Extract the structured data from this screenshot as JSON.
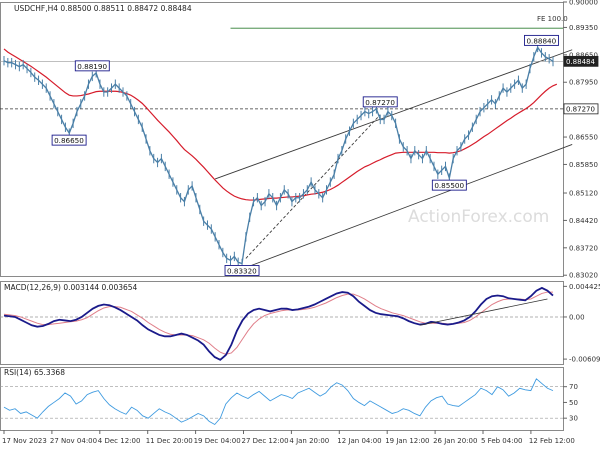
{
  "colors": {
    "price": "#4a7fa7",
    "ema": "#d61c2b",
    "grid": "#c8c8c8",
    "box_border": "#1a1a8a",
    "trend": "#3a3a3a",
    "macd": "#1a1a8a",
    "signal": "#e07f8a",
    "rsi": "#3f9be0",
    "watermark": "#dcdcdc"
  },
  "chart_data": [
    {
      "type": "line",
      "panel": "price",
      "title": "USDCHF,H4  0.88500 0.88511 0.88472 0.88484",
      "watermark": "ActionForex.com",
      "ylim": [
        0.83,
        0.9
      ],
      "y_ticks": [
        "0.90000",
        "0.89350",
        "0.88650",
        "0.87950",
        "0.87270",
        "0.86550",
        "0.85850",
        "0.85120",
        "0.84420",
        "0.83720",
        "0.83020"
      ],
      "last_price_label": "0.88484",
      "level_label": "0.87270",
      "fe_label": "FE 100.0",
      "fe_level": 0.8933,
      "dashed_level": 0.8727,
      "annotations": [
        {
          "text": "0.88190",
          "x": 23,
          "y": 0.8819
        },
        {
          "text": "0.86650",
          "x": 18,
          "y": 0.8665
        },
        {
          "text": "0.83320",
          "x": 62,
          "y": 0.8332
        },
        {
          "text": "0.87270",
          "x": 98,
          "y": 0.8727
        },
        {
          "text": "0.85500",
          "x": 116,
          "y": 0.855
        },
        {
          "text": "0.88840",
          "x": 140,
          "y": 0.8884
        }
      ],
      "x_ticks": [
        "17 Nov 2023",
        "27 Nov 04:00",
        "4 Dec 12:00",
        "11 Dec 20:00",
        "19 Dec 04:00",
        "27 Dec 12:00",
        "4 Jan 20:00",
        "12 Jan 04:00",
        "19 Jan 12:00",
        "26 Jan 20:00",
        "5 Feb 04:00",
        "12 Feb 12:00"
      ],
      "series": [
        {
          "role": "price",
          "values": [
            0.885,
            0.8845,
            0.8845,
            0.884,
            0.8835,
            0.884,
            0.883,
            0.882,
            0.8808,
            0.88,
            0.879,
            0.878,
            0.876,
            0.874,
            0.872,
            0.87,
            0.868,
            0.8665,
            0.869,
            0.872,
            0.874,
            0.876,
            0.879,
            0.881,
            0.8819,
            0.879,
            0.877,
            0.877,
            0.878,
            0.879,
            0.878,
            0.877,
            0.876,
            0.874,
            0.872,
            0.87,
            0.868,
            0.865,
            0.862,
            0.86,
            0.859,
            0.86,
            0.858,
            0.856,
            0.854,
            0.852,
            0.85,
            0.849,
            0.852,
            0.853,
            0.85,
            0.847,
            0.844,
            0.843,
            0.842,
            0.84,
            0.838,
            0.836,
            0.8345,
            0.834,
            0.835,
            0.8335,
            0.8332,
            0.84,
            0.845,
            0.849,
            0.85,
            0.848,
            0.849,
            0.851,
            0.85,
            0.848,
            0.85,
            0.852,
            0.851,
            0.849,
            0.85,
            0.85,
            0.851,
            0.852,
            0.854,
            0.852,
            0.851,
            0.85,
            0.852,
            0.854,
            0.856,
            0.86,
            0.862,
            0.865,
            0.867,
            0.869,
            0.87,
            0.871,
            0.872,
            0.8715,
            0.872,
            0.8727,
            0.87,
            0.87,
            0.872,
            0.871,
            0.869,
            0.865,
            0.863,
            0.862,
            0.86,
            0.862,
            0.861,
            0.86,
            0.862,
            0.86,
            0.858,
            0.856,
            0.857,
            0.858,
            0.855,
            0.86,
            0.862,
            0.863,
            0.865,
            0.866,
            0.868,
            0.87,
            0.872,
            0.873,
            0.874,
            0.875,
            0.874,
            0.876,
            0.878,
            0.877,
            0.878,
            0.879,
            0.88,
            0.878,
            0.879,
            0.883,
            0.886,
            0.8884,
            0.887,
            0.886,
            0.8855,
            0.8848
          ]
        },
        {
          "role": "ema",
          "values": [
            0.888,
            0.8872,
            0.8866,
            0.886,
            0.8854,
            0.8848,
            0.8842,
            0.8836,
            0.8829,
            0.8822,
            0.8815,
            0.8808,
            0.88,
            0.8792,
            0.8784,
            0.8776,
            0.8768,
            0.8762,
            0.876,
            0.876,
            0.8761,
            0.8763,
            0.8765,
            0.8768,
            0.8771,
            0.8772,
            0.8772,
            0.8772,
            0.8772,
            0.8772,
            0.8771,
            0.8769,
            0.8766,
            0.8762,
            0.8756,
            0.8749,
            0.8741,
            0.8731,
            0.872,
            0.8709,
            0.8698,
            0.8688,
            0.8678,
            0.8668,
            0.8657,
            0.8646,
            0.8634,
            0.8623,
            0.8615,
            0.8607,
            0.8598,
            0.8588,
            0.8578,
            0.8567,
            0.8556,
            0.8545,
            0.8535,
            0.8525,
            0.8517,
            0.851,
            0.8504,
            0.85,
            0.8497,
            0.8495,
            0.8494,
            0.8494,
            0.8495,
            0.8496,
            0.8497,
            0.8498,
            0.8499,
            0.8499,
            0.85,
            0.8501,
            0.8502,
            0.8502,
            0.8503,
            0.8504,
            0.8505,
            0.8507,
            0.8509,
            0.851,
            0.8512,
            0.8514,
            0.8517,
            0.8521,
            0.8526,
            0.8532,
            0.8539,
            0.8546,
            0.8553,
            0.856,
            0.8567,
            0.8573,
            0.8579,
            0.8583,
            0.8588,
            0.8593,
            0.8597,
            0.8602,
            0.8606,
            0.861,
            0.8614,
            0.8615,
            0.8616,
            0.8616,
            0.8616,
            0.8616,
            0.8616,
            0.8616,
            0.8616,
            0.8616,
            0.8616,
            0.8615,
            0.8615,
            0.8615,
            0.8614,
            0.8615,
            0.8617,
            0.862,
            0.8625,
            0.863,
            0.8636,
            0.8642,
            0.8649,
            0.8656,
            0.8662,
            0.8669,
            0.8676,
            0.8683,
            0.869,
            0.8697,
            0.8703,
            0.871,
            0.8716,
            0.8722,
            0.8728,
            0.8735,
            0.8743,
            0.8753,
            0.8763,
            0.8772,
            0.878,
            0.8786,
            0.879
          ]
        }
      ]
    },
    {
      "type": "line",
      "panel": "macd",
      "title": "MACD(12,26,9) 0.003144 0.003654",
      "ylim": [
        -0.0068,
        0.0052
      ],
      "y_ticks": [
        "0.004425",
        "0.00",
        "-0.006092"
      ],
      "series": [
        {
          "role": "macd",
          "values": [
            0.0002,
            0.0001,
            0.0,
            -0.0004,
            -0.0008,
            -0.0012,
            -0.0014,
            -0.0013,
            -0.001,
            -0.0006,
            -0.0004,
            -0.0005,
            -0.0006,
            -0.0004,
            0.0,
            0.0006,
            0.0012,
            0.0016,
            0.0018,
            0.0017,
            0.0014,
            0.001,
            0.0005,
            0.0,
            -0.0005,
            -0.0012,
            -0.0018,
            -0.0022,
            -0.0026,
            -0.0028,
            -0.0028,
            -0.0026,
            -0.0024,
            -0.0026,
            -0.003,
            -0.0034,
            -0.004,
            -0.005,
            -0.0058,
            -0.0062,
            -0.0055,
            -0.004,
            -0.002,
            -0.0005,
            0.0005,
            0.001,
            0.0012,
            0.001,
            0.0008,
            0.001,
            0.0012,
            0.0012,
            0.001,
            0.0011,
            0.0013,
            0.0015,
            0.0018,
            0.0022,
            0.0026,
            0.003,
            0.0034,
            0.0036,
            0.0035,
            0.003,
            0.0022,
            0.0016,
            0.001,
            0.0006,
            0.0004,
            0.0003,
            0.0002,
            0.0001,
            -0.0002,
            -0.0006,
            -0.0009,
            -0.0011,
            -0.001,
            -0.0007,
            -0.0008,
            -0.001,
            -0.0011,
            -0.001,
            -0.0008,
            -0.0005,
            0.0,
            0.0008,
            0.0018,
            0.0026,
            0.003,
            0.0031,
            0.003,
            0.0027,
            0.0026,
            0.0025,
            0.0024,
            0.003,
            0.0038,
            0.0042,
            0.0038,
            0.0031
          ]
        },
        {
          "role": "signal",
          "values": [
            0.0004,
            0.0003,
            0.0002,
            0.0,
            -0.0003,
            -0.0006,
            -0.0009,
            -0.0011,
            -0.0011,
            -0.001,
            -0.0009,
            -0.0008,
            -0.0007,
            -0.0006,
            -0.0004,
            -0.0001,
            0.0004,
            0.0009,
            0.0013,
            0.0015,
            0.0015,
            0.0014,
            0.0011,
            0.0008,
            0.0003,
            -0.0002,
            -0.0008,
            -0.0013,
            -0.0018,
            -0.0022,
            -0.0025,
            -0.0026,
            -0.0026,
            -0.0026,
            -0.0027,
            -0.003,
            -0.0033,
            -0.0038,
            -0.0045,
            -0.0051,
            -0.0054,
            -0.0052,
            -0.0044,
            -0.0032,
            -0.002,
            -0.001,
            -0.0003,
            0.0002,
            0.0005,
            0.0007,
            0.0009,
            0.001,
            0.001,
            0.001,
            0.0011,
            0.0012,
            0.0014,
            0.0017,
            0.002,
            0.0024,
            0.0028,
            0.0031,
            0.0033,
            0.0033,
            0.003,
            0.0026,
            0.0021,
            0.0016,
            0.0012,
            0.0009,
            0.0006,
            0.0004,
            0.0002,
            -0.0001,
            -0.0004,
            -0.0007,
            -0.0009,
            -0.0009,
            -0.0009,
            -0.0009,
            -0.001,
            -0.001,
            -0.0009,
            -0.0008,
            -0.0005,
            0.0,
            0.0006,
            0.0012,
            0.0018,
            0.0022,
            0.0025,
            0.0026,
            0.0026,
            0.0026,
            0.0025,
            0.0026,
            0.003,
            0.0034,
            0.0036,
            0.0036
          ]
        }
      ]
    },
    {
      "type": "line",
      "panel": "rsi",
      "title": "RSI(14) 65.3368",
      "ylim": [
        15,
        95
      ],
      "y_ticks": [
        "70",
        "50",
        "30"
      ],
      "levels": [
        70,
        30
      ],
      "series": [
        {
          "role": "rsi",
          "values": [
            44,
            40,
            42,
            36,
            38,
            34,
            30,
            38,
            45,
            50,
            55,
            62,
            58,
            48,
            52,
            60,
            63,
            65,
            55,
            47,
            42,
            38,
            35,
            44,
            40,
            33,
            30,
            36,
            42,
            38,
            35,
            30,
            25,
            28,
            32,
            36,
            33,
            26,
            22,
            30,
            48,
            56,
            62,
            58,
            55,
            60,
            64,
            58,
            52,
            56,
            60,
            58,
            55,
            62,
            65,
            68,
            63,
            58,
            62,
            70,
            75,
            72,
            65,
            55,
            50,
            46,
            52,
            48,
            44,
            40,
            36,
            38,
            42,
            40,
            36,
            33,
            44,
            52,
            56,
            58,
            48,
            46,
            45,
            50,
            55,
            60,
            68,
            65,
            60,
            70,
            66,
            58,
            62,
            68,
            66,
            65,
            80,
            74,
            68,
            65
          ]
        }
      ]
    }
  ]
}
